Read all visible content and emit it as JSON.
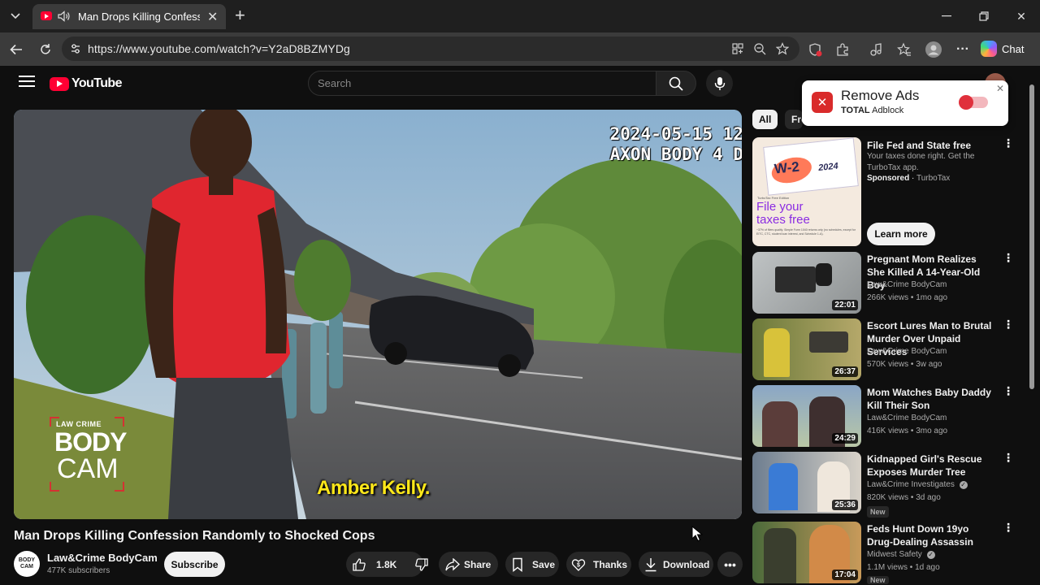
{
  "browser": {
    "tab_title": "Man Drops Killing Confession Randomly to Shocked Cops",
    "url": "https://www.youtube.com/watch?v=Y2aD8BZMYDg",
    "chat_label": "Chat",
    "icons": [
      "tab-dropdown-icon",
      "speaker-icon",
      "close-icon",
      "plus-icon",
      "minimize-icon",
      "restore-icon",
      "back-icon",
      "reload-icon",
      "site-info-icon",
      "app-icon",
      "zoom-icon",
      "star-icon",
      "shield-icon",
      "extensions-icon",
      "media-icon",
      "favorites-icon",
      "profile-icon",
      "more-icon"
    ],
    "colors": {
      "tab_bar": "#1f1f1f",
      "toolbar": "#3b3b3b",
      "omnibox": "#2b2b2b"
    }
  },
  "youtube": {
    "logo_text": "YouTube",
    "search_placeholder": "Search",
    "colors": {
      "background": "#0f0f0f",
      "brand_red": "#ff0033",
      "pill": "#272727"
    }
  },
  "video": {
    "overlay_timestamp": "2024-05-15 12\nAXON BODY 4 D",
    "caption": "Amber Kelly.",
    "watermark": {
      "line1": "LAW CRIME",
      "line2": "BODY",
      "line3": "CAM"
    },
    "title": "Man Drops Killing Confession Randomly to Shocked Cops",
    "channel": {
      "name": "Law&Crime BodyCam",
      "subscribers": "477K subscribers",
      "avatar_text": "BODY CAM"
    },
    "subscribe_label": "Subscribe",
    "likes": "1.8K",
    "share_label": "Share",
    "save_label": "Save",
    "thanks_label": "Thanks",
    "download_label": "Download"
  },
  "chips": {
    "all": "All",
    "from": "Fro"
  },
  "adblock": {
    "heading": "Remove Ads",
    "brand_bold": "TOTAL",
    "brand_rest": " Adblock",
    "toggle_on": false
  },
  "sidebar": {
    "ad": {
      "title": "File Fed and State free",
      "desc": "Your taxes done right. Get the TurboTax app.",
      "sponsored": "Sponsored",
      "advertiser": "TurboTax",
      "cta": "Learn more",
      "thumb_w2": "W-2",
      "thumb_year": "2024",
      "thumb_headline": "File your taxes free",
      "thumb_small": "TurboTax Free Edition",
      "thumb_fineprint": "~37% of filers qualify. Simple Form 1040 returns only (no schedules, except for EITC, CTC, student loan interest, and Schedule 1-A)."
    },
    "videos": [
      {
        "title": "Pregnant Mom Realizes She Killed A 14-Year-Old Boy",
        "channel": "Law&Crime BodyCam",
        "meta": "266K views • 1mo ago",
        "duration": "22:01",
        "verified": false,
        "badge": ""
      },
      {
        "title": "Escort Lures Man to Brutal Murder Over Unpaid Services",
        "channel": "Law&Crime BodyCam",
        "meta": "570K views • 3w ago",
        "duration": "26:37",
        "verified": false,
        "badge": ""
      },
      {
        "title": "Mom Watches Baby Daddy Kill Their Son",
        "channel": "Law&Crime BodyCam",
        "meta": "416K views • 3mo ago",
        "duration": "24:29",
        "verified": false,
        "badge": ""
      },
      {
        "title": "Kidnapped Girl's Rescue Exposes Murder Tree",
        "channel": "Law&Crime Investigates",
        "meta": "820K views • 3d ago",
        "duration": "25:36",
        "verified": true,
        "badge": "New"
      },
      {
        "title": "Feds Hunt Down 19yo Drug-Dealing Assassin",
        "channel": "Midwest Safety",
        "meta": "1.1M views • 1d ago",
        "duration": "17:04",
        "verified": true,
        "badge": "New"
      }
    ]
  }
}
